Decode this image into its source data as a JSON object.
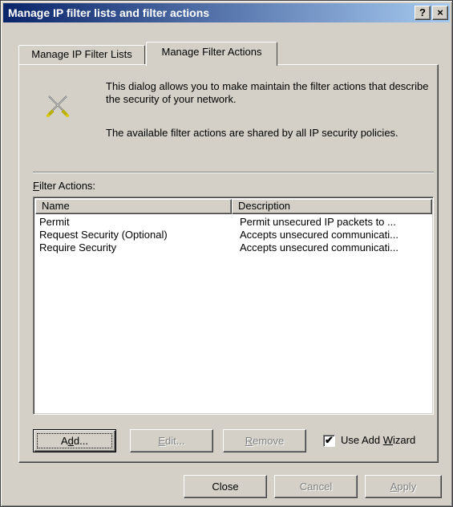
{
  "window": {
    "title": "Manage IP filter lists and filter actions",
    "help_glyph": "?",
    "close_glyph": "×"
  },
  "tabs": [
    {
      "label": "Manage IP Filter Lists",
      "active": false
    },
    {
      "label": "Manage Filter Actions",
      "active": true
    }
  ],
  "icons": {
    "filter_action_icon": "crossed-swords-icon"
  },
  "info": {
    "line1": "This dialog allows you to make maintain the filter actions that describe the security of your network.",
    "line2": "The available filter actions are shared by all IP security policies."
  },
  "filter_actions": {
    "label_prefix": "F",
    "label_rest": "ilter Actions:",
    "columns": [
      "Name",
      "Description"
    ],
    "rows": [
      {
        "name": "Permit",
        "description": "Permit unsecured IP packets to ..."
      },
      {
        "name": "Request Security (Optional)",
        "description": "Accepts unsecured communicati..."
      },
      {
        "name": "Require Security",
        "description": "Accepts unsecured communicati..."
      }
    ]
  },
  "buttons": {
    "add": {
      "pre": "A",
      "ul": "d",
      "post": "d..."
    },
    "edit": {
      "pre": "",
      "ul": "E",
      "post": "dit..."
    },
    "remove": {
      "pre": "",
      "ul": "R",
      "post": "emove"
    },
    "close": "Close",
    "cancel": "Cancel",
    "apply": {
      "pre": "",
      "ul": "A",
      "post": "pply"
    }
  },
  "wizard": {
    "checked": true,
    "check_glyph": "✔",
    "label_pre": "Use Add ",
    "label_ul": "W",
    "label_post": "izard"
  }
}
